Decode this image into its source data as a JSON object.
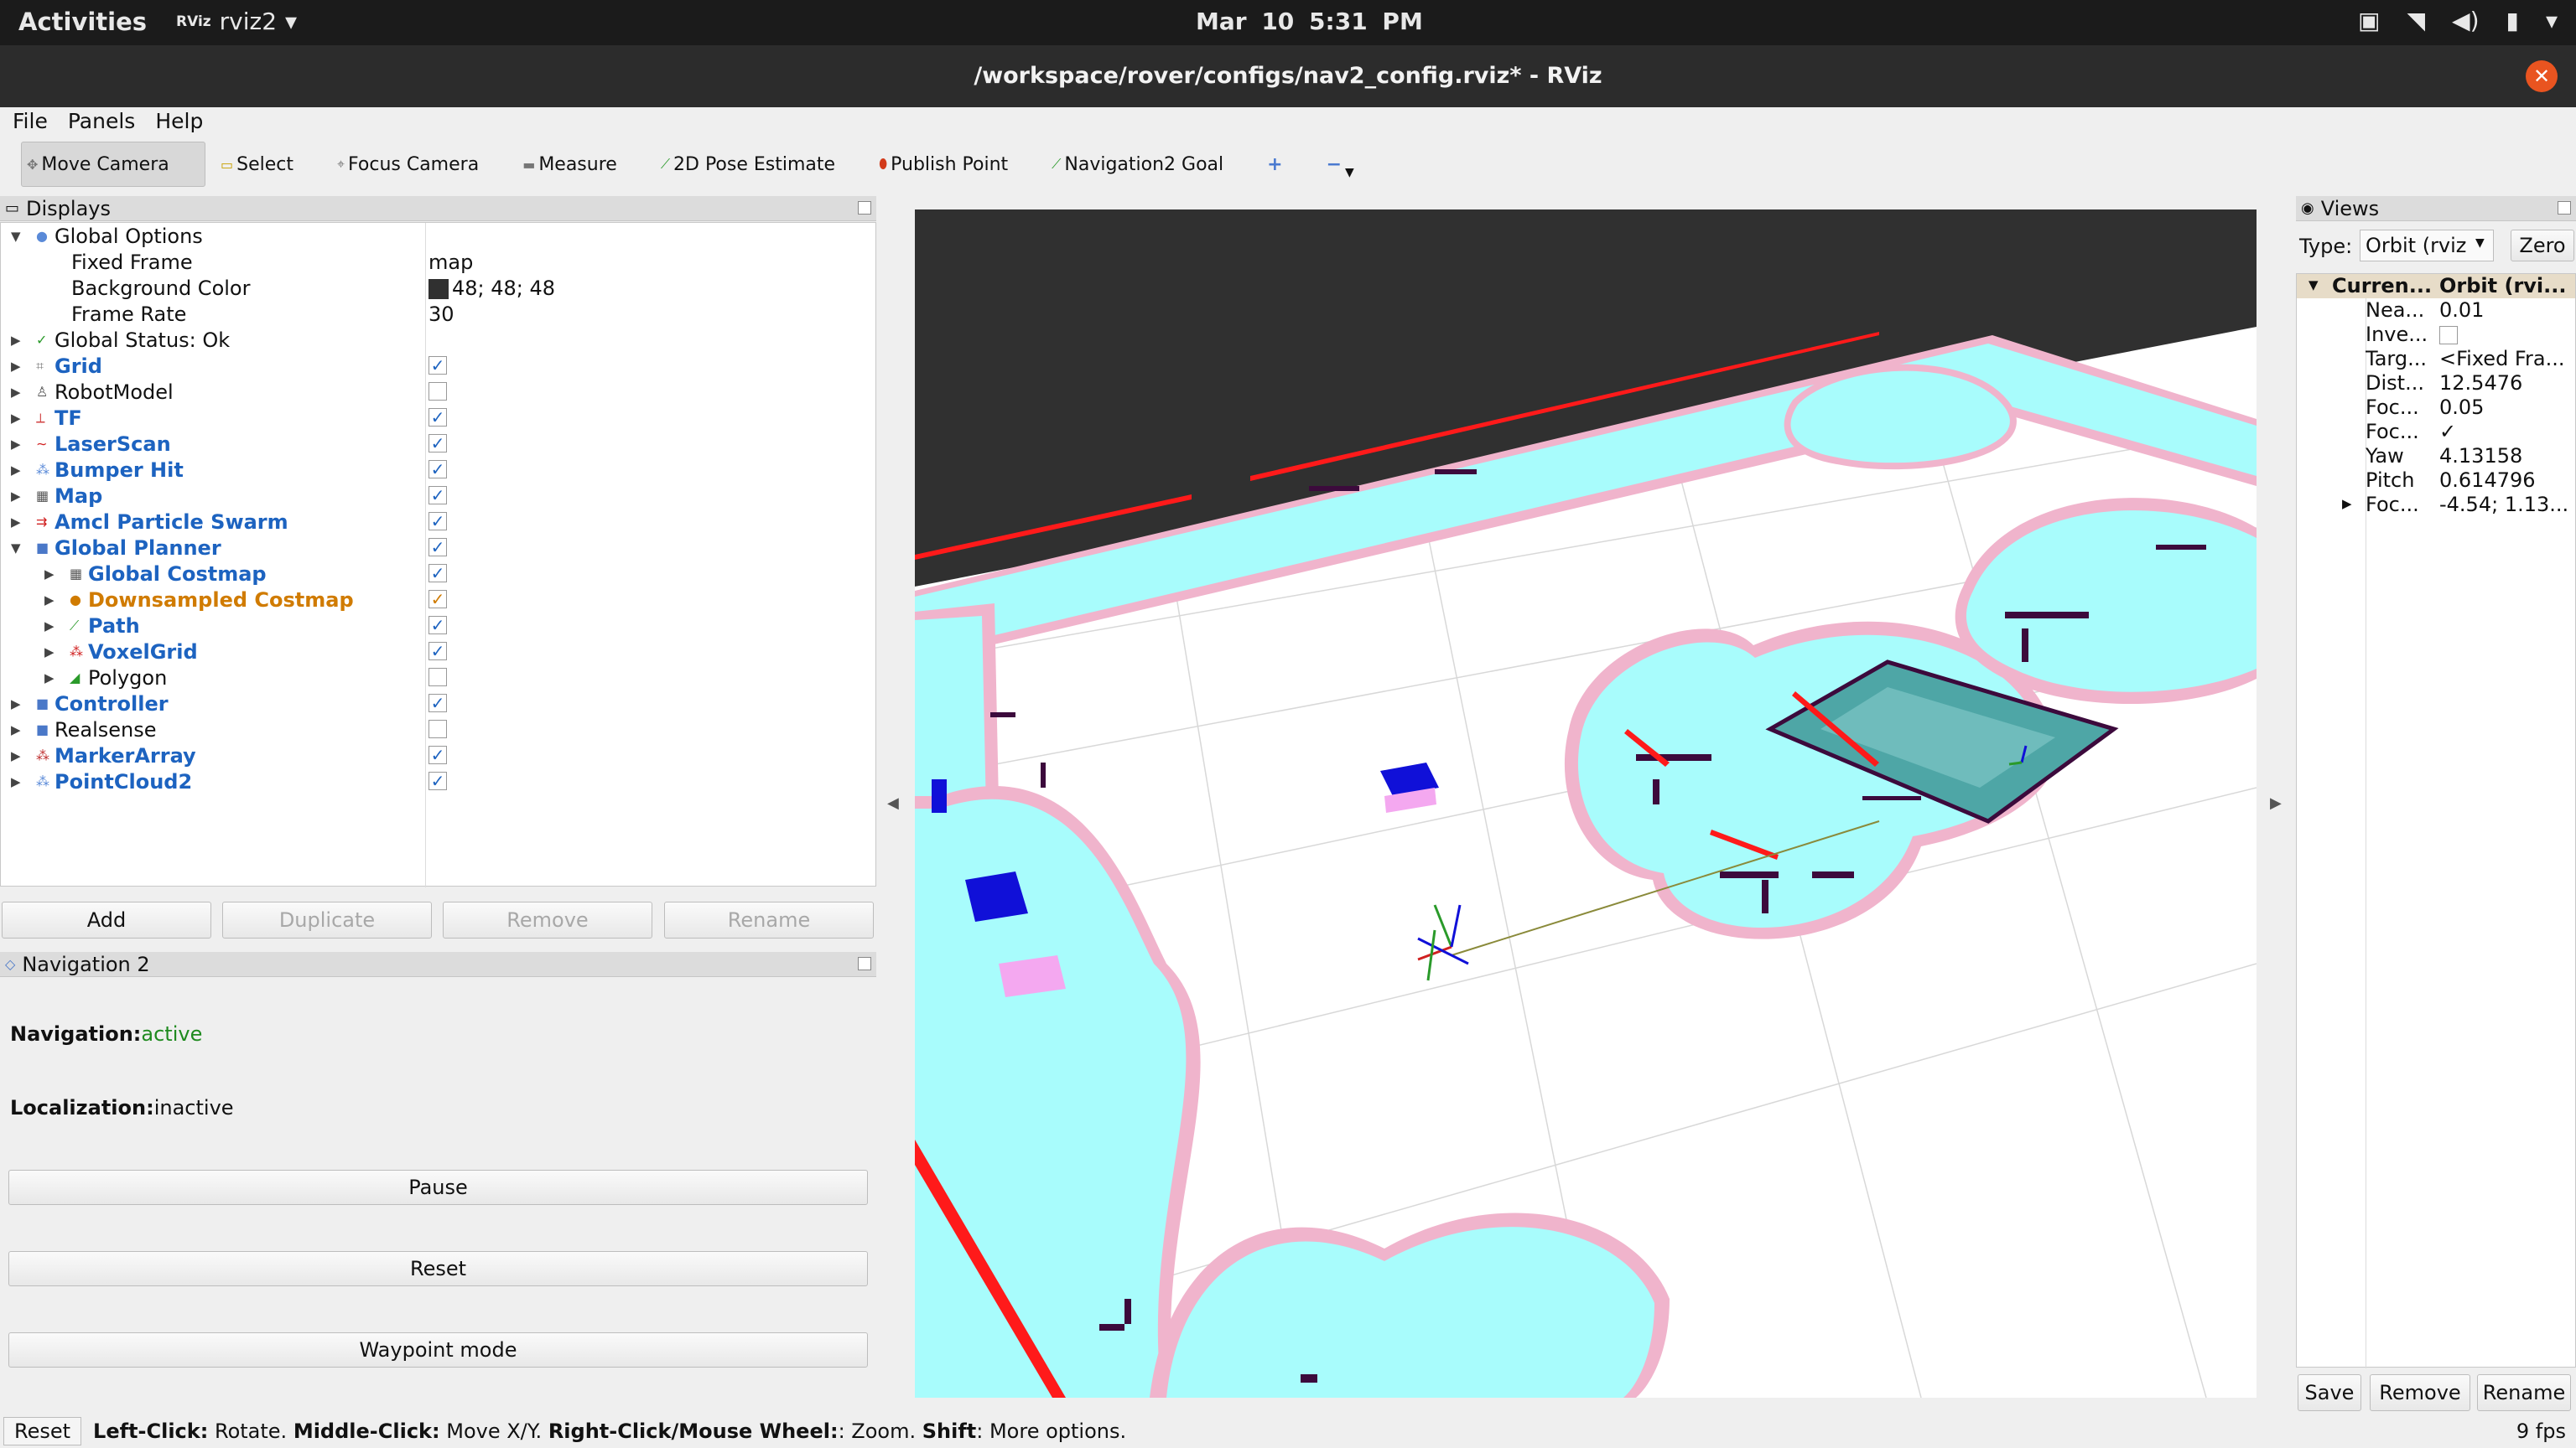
{
  "topbar": {
    "activities": "Activities",
    "app_menu": "rviz2",
    "app_badge": "RViz",
    "clock": "Mar 10  5:31 PM",
    "tray_icons": [
      "screen-icon",
      "wifi-icon",
      "volume-icon",
      "battery-icon",
      "power-chevron-icon"
    ]
  },
  "window": {
    "title": "/workspace/rover/configs/nav2_config.rviz* - RViz",
    "close_glyph": "✕"
  },
  "menu": {
    "file": "File",
    "panels": "Panels",
    "help": "Help"
  },
  "toolbar": {
    "move_camera": "Move Camera",
    "select": "Select",
    "focus_camera": "Focus Camera",
    "measure": "Measure",
    "pose_estimate": "2D Pose Estimate",
    "publish_point": "Publish Point",
    "nav2_goal": "Navigation2 Goal",
    "add_tool": "+",
    "remove_tool": "−"
  },
  "displays": {
    "title": "Displays",
    "global_options": "Global Options",
    "fixed_frame_label": "Fixed Frame",
    "fixed_frame_value": "map",
    "bg_color_label": "Background Color",
    "bg_color_value": "48; 48; 48",
    "frame_rate_label": "Frame Rate",
    "frame_rate_value": "30",
    "global_status": "Global Status: Ok",
    "grid": "Grid",
    "robot_model": "RobotModel",
    "tf": "TF",
    "laser_scan": "LaserScan",
    "bumper_hit": "Bumper Hit",
    "map": "Map",
    "amcl": "Amcl Particle Swarm",
    "global_planner": "Global Planner",
    "global_costmap": "Global Costmap",
    "downsampled_costmap": "Downsampled Costmap",
    "path": "Path",
    "voxel_grid": "VoxelGrid",
    "polygon": "Polygon",
    "controller": "Controller",
    "realsense": "Realsense",
    "marker_array": "MarkerArray",
    "pointcloud2": "PointCloud2",
    "check": "✓"
  },
  "display_buttons": {
    "add": "Add",
    "duplicate": "Duplicate",
    "remove": "Remove",
    "rename": "Rename"
  },
  "nav2": {
    "title": "Navigation 2",
    "navigation_label": "Navigation:",
    "navigation_value": "active",
    "localization_label": "Localization:",
    "localization_value": "inactive",
    "pause": "Pause",
    "reset": "Reset",
    "waypoint_mode": "Waypoint mode"
  },
  "views": {
    "title": "Views",
    "type_label": "Type:",
    "type_value": "Orbit (rviz",
    "zero": "Zero",
    "current_label": "Curren...",
    "current_value": "Orbit (rvi...",
    "rows": [
      {
        "k": "Nea...",
        "v": "0.01"
      },
      {
        "k": "Inve...",
        "v": ""
      },
      {
        "k": "Targ...",
        "v": "<Fixed Fra..."
      },
      {
        "k": "Dist...",
        "v": "12.5476"
      },
      {
        "k": "Foc...",
        "v": "0.05"
      },
      {
        "k": "Foc...",
        "v": "✓"
      },
      {
        "k": "Yaw",
        "v": "4.13158"
      },
      {
        "k": "Pitch",
        "v": "0.614796"
      },
      {
        "k": "Foc...",
        "v": "-4.54; 1.13..."
      }
    ],
    "save": "Save",
    "remove": "Remove",
    "rename": "Rename"
  },
  "statusbar": {
    "reset": "Reset",
    "left_click": "Left-Click:",
    "rotate": " Rotate. ",
    "middle_click": "Middle-Click:",
    "move_xy": " Move X/Y. ",
    "right_click": "Right-Click/Mouse Wheel:",
    "zoom": ": Zoom. ",
    "shift": "Shift",
    "more": ": More options.",
    "fps": "9 fps"
  },
  "colors": {
    "background_3d": "#303030",
    "floor": "#ffffff",
    "costmap_cyan": "#a8fcfc",
    "inflation_pink": "#f0b4cc",
    "obstacle_dark": "#3c0a3c",
    "laser_red": "#ff1a1a",
    "teal": "#4ea6a6",
    "link_blue": "#1d63c0",
    "warn_orange": "#d07b00",
    "active_green": "#1f8a1f"
  }
}
